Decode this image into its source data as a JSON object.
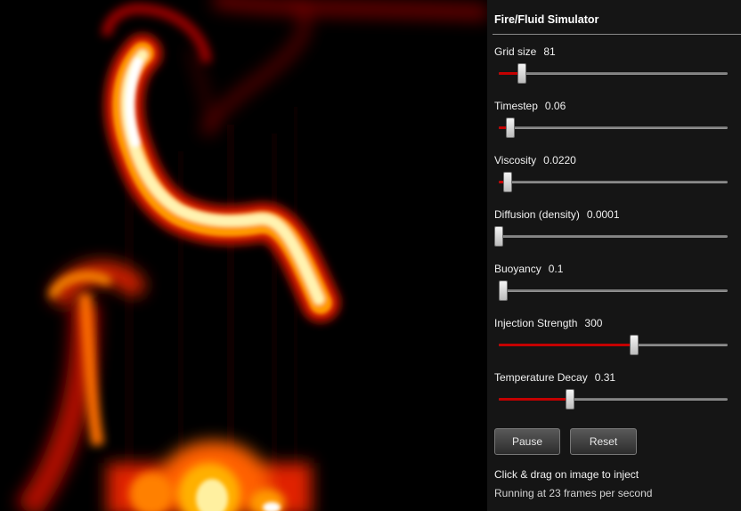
{
  "panel": {
    "title": "Fire/Fluid Simulator",
    "controls": [
      {
        "label": "Grid size",
        "value": "81",
        "fraction": 0.1
      },
      {
        "label": "Timestep",
        "value": "0.06",
        "fraction": 0.05
      },
      {
        "label": "Viscosity",
        "value": "0.0220",
        "fraction": 0.04
      },
      {
        "label": "Diffusion (density)",
        "value": "0.0001",
        "fraction": 0.0
      },
      {
        "label": "Buoyancy",
        "value": "0.1",
        "fraction": 0.02
      },
      {
        "label": "Injection Strength",
        "value": "300",
        "fraction": 0.59
      },
      {
        "label": "Temperature Decay",
        "value": "0.31",
        "fraction": 0.31
      }
    ],
    "buttons": {
      "pause": "Pause",
      "reset": "Reset"
    },
    "hint": "Click & drag on image to inject",
    "status": "Running at 23 frames per second"
  },
  "colors": {
    "panel_bg": "#151515",
    "slider_fill": "#c40000",
    "fire_hot": "#ffffff",
    "fire_mid": "#ffb000",
    "fire_low": "#b00000"
  }
}
